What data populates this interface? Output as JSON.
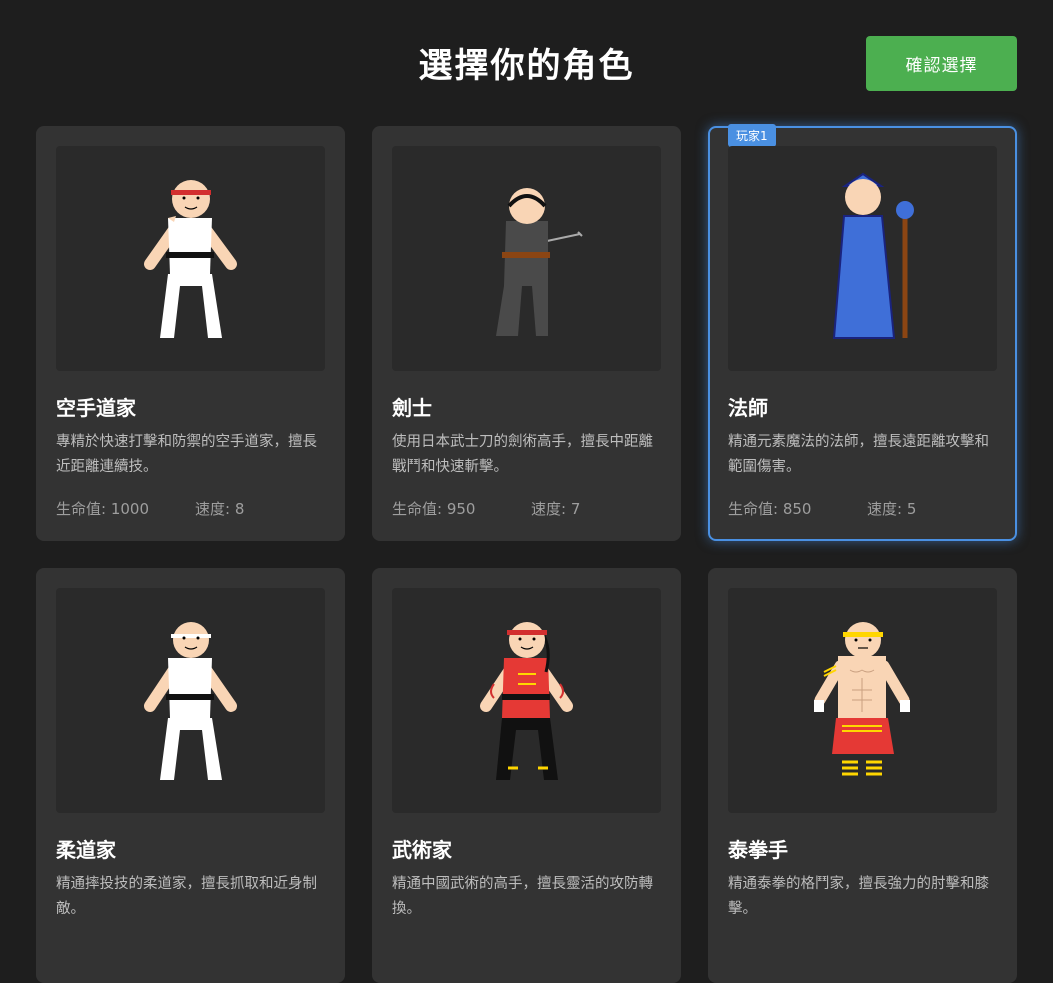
{
  "header": {
    "title": "選擇你的角色",
    "confirm_label": "確認選擇"
  },
  "stat_labels": {
    "hp": "生命值: ",
    "speed": "速度: "
  },
  "characters": [
    {
      "name": "空手道家",
      "description": "專精於快速打擊和防禦的空手道家，擅長近距離連續技。",
      "hp": "1000",
      "speed": "8",
      "hp_text": "生命值: 1000",
      "speed_text": "速度: 8",
      "selected": false
    },
    {
      "name": "劍士",
      "description": "使用日本武士刀的劍術高手，擅長中距離戰鬥和快速斬擊。",
      "hp": "950",
      "speed": "7",
      "hp_text": "生命值: 950",
      "speed_text": "速度: 7",
      "selected": false
    },
    {
      "name": "法師",
      "description": "精通元素魔法的法師，擅長遠距離攻擊和範圍傷害。",
      "hp": "850",
      "speed": "5",
      "hp_text": "生命值: 850",
      "speed_text": "速度: 5",
      "selected": true,
      "badge": "玩家1"
    },
    {
      "name": "柔道家",
      "description": "精通摔投技的柔道家，擅長抓取和近身制敵。",
      "selected": false
    },
    {
      "name": "武術家",
      "description": "精通中國武術的高手，擅長靈活的攻防轉換。",
      "selected": false
    },
    {
      "name": "泰拳手",
      "description": "精通泰拳的格鬥家，擅長強力的肘擊和膝擊。",
      "selected": false
    }
  ],
  "colors": {
    "background": "#1e1e1e",
    "card": "#333333",
    "confirm": "#4caf50",
    "selected_border": "#4a90e2"
  }
}
